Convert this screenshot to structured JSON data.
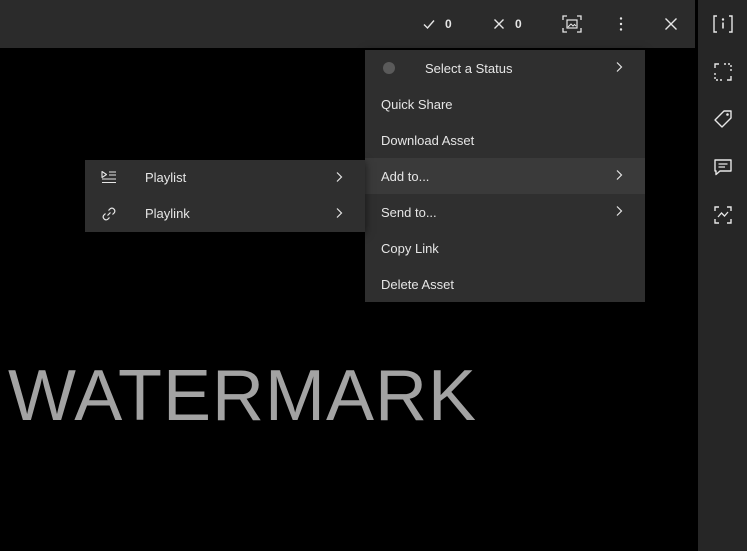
{
  "toolbar": {
    "approve_count": "0",
    "reject_count": "0",
    "icons": [
      "check-icon",
      "close-x-icon",
      "fit-to-screen-icon",
      "more-vertical-icon",
      "close-icon"
    ]
  },
  "context_menu": {
    "items": [
      {
        "label": "Select a Status",
        "has_submenu": true
      },
      {
        "label": "Quick Share",
        "has_submenu": false
      },
      {
        "label": "Download Asset",
        "has_submenu": false
      },
      {
        "label": "Add to...",
        "has_submenu": true,
        "active": true
      },
      {
        "label": "Send to...",
        "has_submenu": true
      },
      {
        "label": "Copy Link",
        "has_submenu": false
      },
      {
        "label": "Delete Asset",
        "has_submenu": false
      }
    ]
  },
  "add_to_submenu": {
    "items": [
      {
        "label": "Playlist",
        "icon": "playlist-icon"
      },
      {
        "label": "Playlink",
        "icon": "link-icon"
      }
    ]
  },
  "viewer": {
    "watermark": "WATERMARK"
  },
  "sidebar": {
    "icons": [
      "info-icon",
      "crop-icon",
      "tag-icon",
      "comment-icon",
      "compare-icon"
    ]
  },
  "colors": {
    "topbar_bg": "#2b2b2b",
    "menu_bg": "#2f2f2f",
    "menu_active_bg": "#3a3a3a",
    "sidebar_bg": "#262626",
    "watermark": "#a3a3a3"
  }
}
